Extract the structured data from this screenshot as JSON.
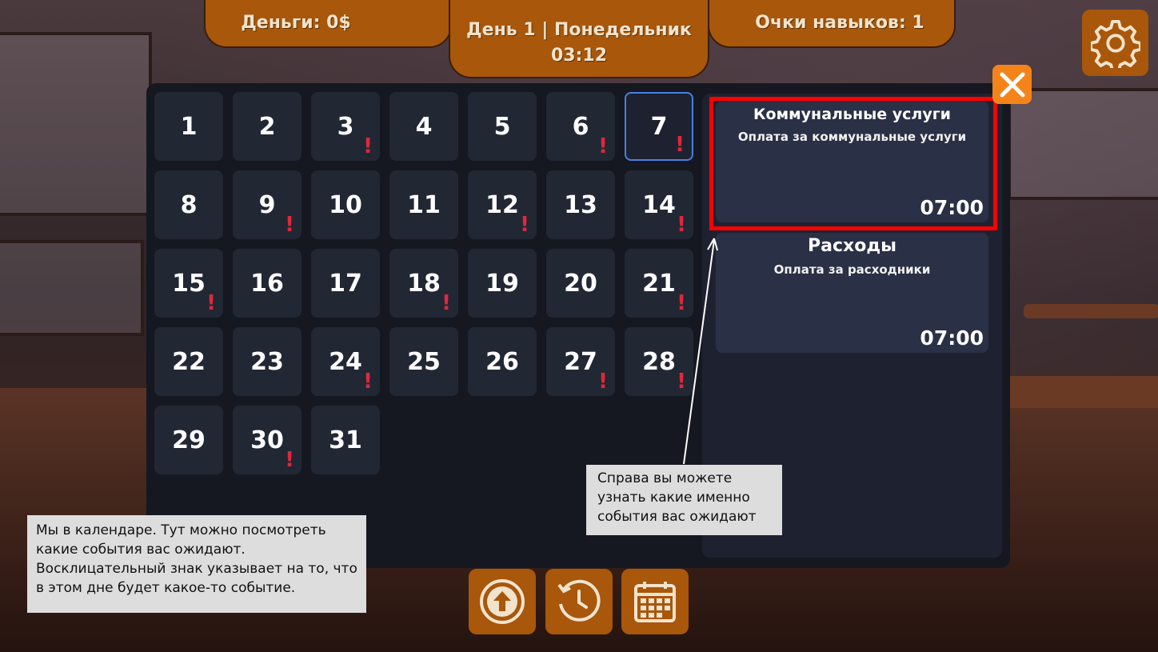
{
  "hud": {
    "money": "Деньги: 0$",
    "day": "День 1 | Понедельник",
    "time": "03:12",
    "skill_points": "Очки навыков: 1"
  },
  "calendar": {
    "selected_day": 7,
    "days": [
      {
        "n": "1",
        "event": false
      },
      {
        "n": "2",
        "event": false
      },
      {
        "n": "3",
        "event": true
      },
      {
        "n": "4",
        "event": false
      },
      {
        "n": "5",
        "event": false
      },
      {
        "n": "6",
        "event": true
      },
      {
        "n": "7",
        "event": true
      },
      {
        "n": "8",
        "event": false
      },
      {
        "n": "9",
        "event": true
      },
      {
        "n": "10",
        "event": false
      },
      {
        "n": "11",
        "event": false
      },
      {
        "n": "12",
        "event": true
      },
      {
        "n": "13",
        "event": false
      },
      {
        "n": "14",
        "event": true
      },
      {
        "n": "15",
        "event": true
      },
      {
        "n": "16",
        "event": false
      },
      {
        "n": "17",
        "event": false
      },
      {
        "n": "18",
        "event": true
      },
      {
        "n": "19",
        "event": false
      },
      {
        "n": "20",
        "event": false
      },
      {
        "n": "21",
        "event": true
      },
      {
        "n": "22",
        "event": false
      },
      {
        "n": "23",
        "event": false
      },
      {
        "n": "24",
        "event": true
      },
      {
        "n": "25",
        "event": false
      },
      {
        "n": "26",
        "event": false
      },
      {
        "n": "27",
        "event": true
      },
      {
        "n": "28",
        "event": true
      },
      {
        "n": "29",
        "event": false
      },
      {
        "n": "30",
        "event": true
      },
      {
        "n": "31",
        "event": false
      }
    ],
    "event_mark": "!"
  },
  "events": [
    {
      "title": "Коммунальные услуги",
      "description": "Оплата за коммунальные услуги",
      "time": "07:00"
    },
    {
      "title": "Расходы",
      "description": "Оплата за расходники",
      "time": "07:00"
    }
  ],
  "tooltips": {
    "left": "Мы в календаре. Тут можно посмотреть какие события вас ожидают. Восклицательный знак указывает на то, что в этом дне будет какое-то событие.",
    "right": "Справа вы можете узнать какие именно события вас ожидают"
  },
  "icons": {
    "settings": "gear-icon",
    "close": "close-icon",
    "bottom": [
      "arrow-up-circle-icon",
      "history-clock-icon",
      "calendar-icon"
    ]
  },
  "colors": {
    "accent_orange": "#a8570b",
    "close_orange": "#f4841a",
    "event_mark_red": "#e0283a",
    "highlight_red": "#ff0000",
    "selected_blue": "#4a7fe0"
  }
}
